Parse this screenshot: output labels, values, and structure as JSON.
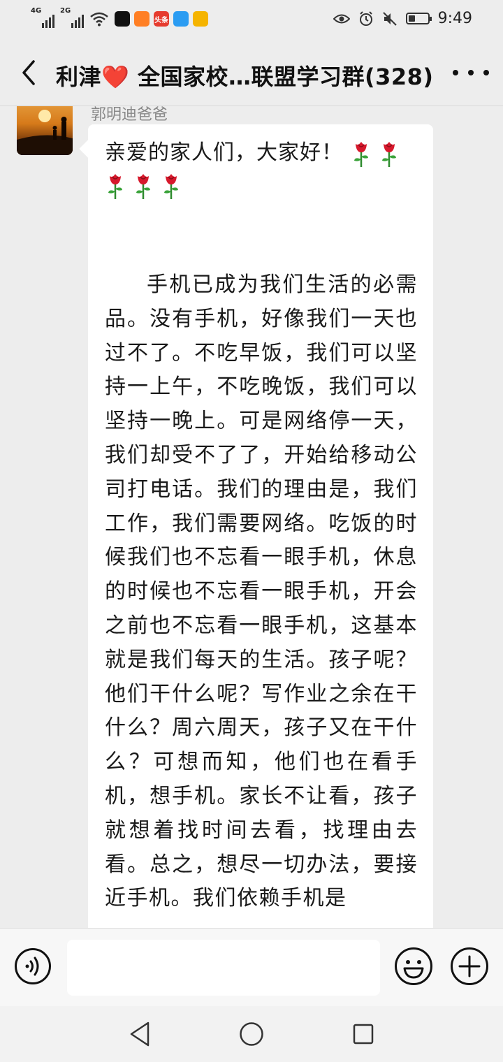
{
  "status_bar": {
    "network1": "4G",
    "network2": "2G",
    "time": "9:49",
    "battery_level": 0.35,
    "apps": [
      {
        "icon": "video-app-icon",
        "color": "#111111",
        "label": ""
      },
      {
        "icon": "kuaishou-app-icon",
        "color": "#ff7f24",
        "label": ""
      },
      {
        "icon": "toutiao-app-icon",
        "color": "#e63b2e",
        "label": "头条"
      },
      {
        "icon": "chat-app-icon",
        "color": "#2b9cf2",
        "label": ""
      },
      {
        "icon": "music-app-icon",
        "color": "#f5b400",
        "label": ""
      }
    ]
  },
  "header": {
    "title": "利津❤️ 全国家校…联盟学习群(328)"
  },
  "message": {
    "sender": "郭明迪爸爸",
    "greeting": "亲爱的家人们，大家好！",
    "rose_icon": "rose-emoji",
    "rose_count_first_line": 2,
    "rose_count_second_line": 3,
    "body": "手机已成为我们生活的必需品。没有手机，好像我们一天也过不了。不吃早饭，我们可以坚持一上午，不吃晚饭，我们可以坚持一晚上。可是网络停一天，我们却受不了了，开始给移动公司打电话。我们的理由是，我们工作，我们需要网络。吃饭的时候我们也不忘看一眼手机，休息的时候也不忘看一眼手机，开会之前也不忘看一眼手机，这基本就是我们每天的生活。孩子呢？他们干什么呢？写作业之余在干什么？周六周天，孩子又在干什么？可想而知，他们也在看手机，想手机。家长不让看，孩子就想着找时间去看，找理由去看。总之，想尽一切办法，要接近手机。我们依赖手机是"
  },
  "input_bar": {
    "value": "",
    "placeholder": ""
  }
}
